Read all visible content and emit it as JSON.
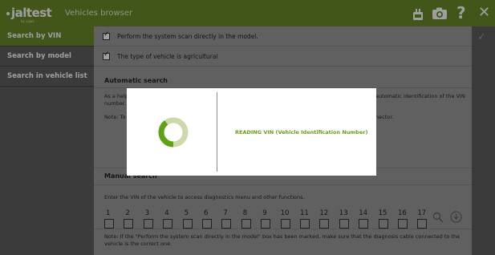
{
  "header": {
    "logo_text": "jaltest",
    "logo_sub": "by cojali",
    "title": "Vehicles browser"
  },
  "sidebar": {
    "items": [
      {
        "label": "Search by VIN",
        "active": true
      },
      {
        "label": "Search by model",
        "active": false
      },
      {
        "label": "Search in vehicle list",
        "active": false
      }
    ]
  },
  "options": [
    {
      "label": "Perform the system scan directly in the model.",
      "checked": true
    },
    {
      "label": "The type of vehicle is agricultural",
      "checked": true
    }
  ],
  "automatic": {
    "title": "Automatic search",
    "line1a": "As a help",
    "line1b": "automatic identification of the VIN",
    "line1c": "number.",
    "note_a": "Note: To",
    "note_b": "nector."
  },
  "manual": {
    "title": "Manual search",
    "instruction": "Enter the VIN of the vehicle to access diagnostics menu and other functions.",
    "positions": [
      "1",
      "2",
      "3",
      "4",
      "5",
      "6",
      "7",
      "8",
      "9",
      "10",
      "11",
      "12",
      "13",
      "14",
      "15",
      "16",
      "17"
    ],
    "note": "Note: If the \"Perform the system scan directly in the model\" box has been marked, make sure that the diagnosis cable connected to the vehicle is the correct one."
  },
  "modal": {
    "message": "READING VIN (Vehicle Identification Number)",
    "progress": 0.4
  },
  "colors": {
    "brand_green": "#6c8c29",
    "accent_text_green": "#6c9b1d",
    "panel_gray": "#9c9c9c",
    "sidebar_gray": "#5f5f5f"
  }
}
